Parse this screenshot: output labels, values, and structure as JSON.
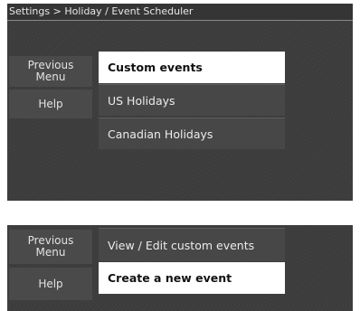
{
  "screen1": {
    "breadcrumb": "Settings > Holiday / Event Scheduler",
    "side_buttons": {
      "previous_menu": "Previous\nMenu",
      "help": "Help"
    },
    "menu_items": [
      {
        "label": "Custom events",
        "selected": true
      },
      {
        "label": "US Holidays",
        "selected": false
      },
      {
        "label": "Canadian Holidays",
        "selected": false
      }
    ]
  },
  "screen2": {
    "side_buttons": {
      "previous_menu": "Previous\nMenu",
      "help": "Help"
    },
    "menu_items": [
      {
        "label": "View / Edit custom events",
        "selected": false
      },
      {
        "label": "Create a new event",
        "selected": true
      }
    ]
  },
  "colors": {
    "screen_bg": "#3b3b3b",
    "button_bg": "#4a4a4a",
    "selected_bg": "#ffffff",
    "text_light": "#e8e8e8"
  }
}
